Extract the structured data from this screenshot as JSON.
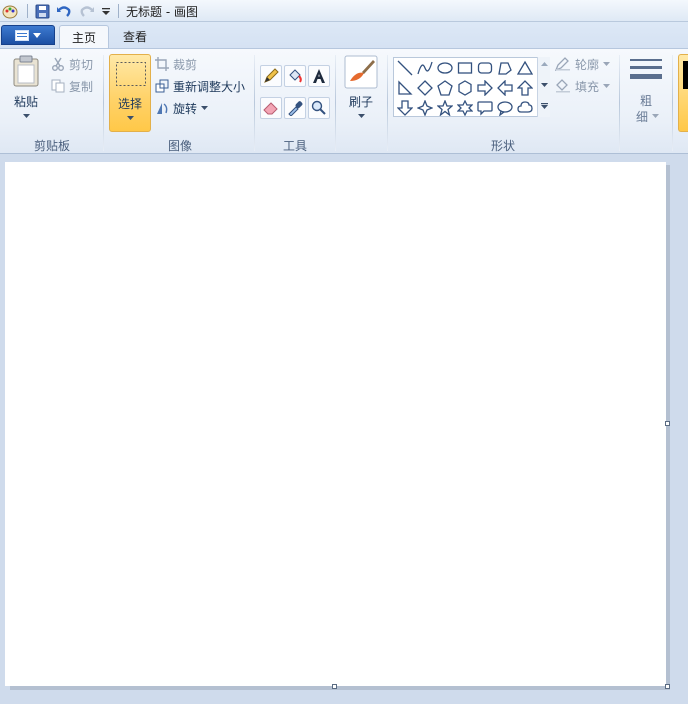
{
  "window": {
    "title": "无标题 - 画图"
  },
  "tabs": [
    {
      "label": "主页",
      "active": true
    },
    {
      "label": "查看",
      "active": false
    }
  ],
  "clipboard": {
    "paste": "粘贴",
    "cut": "剪切",
    "copy": "复制",
    "group": "剪贴板"
  },
  "image": {
    "select": "选择",
    "crop": "裁剪",
    "resize": "重新调整大小",
    "rotate": "旋转",
    "group": "图像"
  },
  "tools": {
    "group": "工具"
  },
  "brushes": {
    "label": "刷子"
  },
  "shapes": {
    "outline": "轮廓",
    "fill": "填充",
    "group": "形状"
  },
  "size": {
    "label_top": "粗",
    "label_bottom": "细"
  },
  "colors": {
    "accent": "#ffc848",
    "ribbon": "#eaf0f8",
    "background": "#cfdbec"
  }
}
